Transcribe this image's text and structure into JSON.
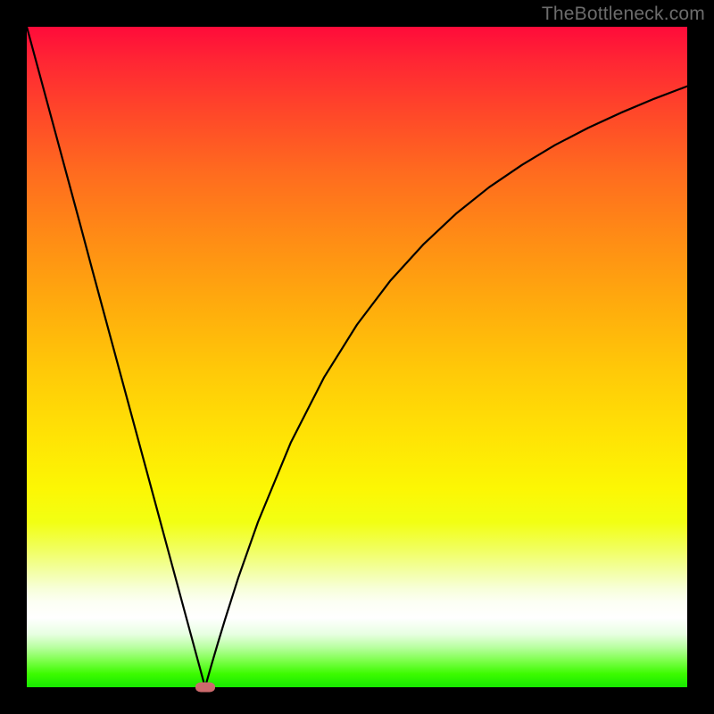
{
  "watermark": "TheBottleneck.com",
  "colors": {
    "curve_stroke": "#000000",
    "marker_fill": "#cc6a6d",
    "frame_bg": "#000000"
  },
  "chart_data": {
    "type": "line",
    "title": "",
    "xlabel": "",
    "ylabel": "",
    "xlim": [
      0,
      100
    ],
    "ylim": [
      0,
      100
    ],
    "grid": false,
    "legend": false,
    "x": [
      0,
      2,
      4,
      6,
      8,
      10,
      12,
      14,
      16,
      18,
      20,
      22,
      24,
      26,
      27,
      28,
      29,
      30,
      32,
      35,
      40,
      45,
      50,
      55,
      60,
      65,
      70,
      75,
      80,
      85,
      90,
      95,
      100
    ],
    "values": [
      100,
      92.6,
      85.2,
      77.8,
      70.4,
      62.9,
      55.5,
      48.1,
      40.7,
      33.3,
      25.9,
      18.5,
      11.1,
      3.7,
      0.0,
      3.5,
      6.9,
      10.2,
      16.5,
      25.0,
      37.1,
      46.9,
      54.9,
      61.5,
      67.0,
      71.7,
      75.7,
      79.1,
      82.1,
      84.7,
      87.0,
      89.1,
      91.0
    ],
    "marker": {
      "x": 27,
      "y": 0
    },
    "notes": "Y axis inverted visually in image rendering; values here are in data space (0 at bottom, 100 at top)."
  }
}
